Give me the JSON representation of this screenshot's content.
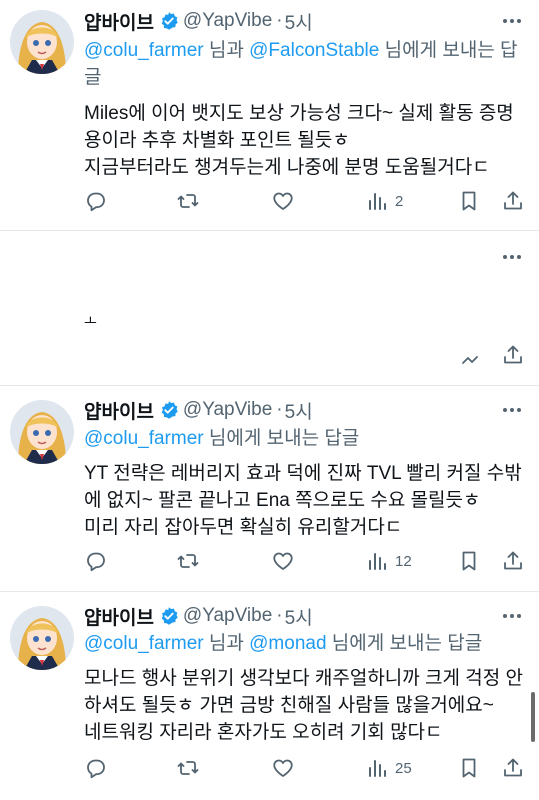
{
  "tweets": [
    {
      "name": "얍바이브",
      "handle": "@YapVibe",
      "time": "5시",
      "reply_prefix": "",
      "mention1": "@colu_farmer",
      "mid": " 님과 ",
      "mention2": "@FalconStable",
      "suffix": " 님에게 보내는 답글",
      "lines": [
        "Miles에 이어 뱃지도 보상 가능성 크다~ 실제 활동 증명",
        "용이라 추후 차별화 포인트 될듯ㅎ",
        "지금부터라도 챙겨두는게 나중에 분명 도움될거다ㄷ"
      ],
      "views": "2"
    },
    {
      "name": "얍바이브",
      "handle": "@YapVibe",
      "time": "5시",
      "mention1": "@colu_farmer",
      "suffix": " 님에게 보내는 답글",
      "lines": [
        "YT 전략은 레버리지 효과 덕에 진짜 TVL 빨리 커질 수밖",
        "에 없지~ 팔콘 끝나고 Ena 쪽으로도 수요 몰릴듯ㅎ",
        "미리 자리 잡아두면 확실히 유리할거다ㄷ"
      ],
      "views": "12"
    },
    {
      "name": "얍바이브",
      "handle": "@YapVibe",
      "time": "5시",
      "mention1": "@colu_farmer",
      "mid": " 님과 ",
      "mention2": "@monad",
      "suffix": " 님에게 보내는 답글",
      "lines": [
        "모나드 행사 분위기 생각보다 캐주얼하니까 크게 걱정 안",
        "하셔도 될듯ㅎ 가면 금방 친해질 사람들 많을거에요~",
        "네트워킹 자리라 혼자가도 오히려 기회 많다ㄷ"
      ],
      "views": "25"
    }
  ],
  "partial_text": "ㅗ",
  "icons": {
    "reply": "reply-icon",
    "retweet": "retweet-icon",
    "like": "heart-icon",
    "views": "views-icon",
    "bookmark": "bookmark-icon",
    "share": "share-icon",
    "more": "more-icon",
    "verified": "verified-badge-icon"
  },
  "colors": {
    "link": "#1d9bf0",
    "secondary": "#536471",
    "text": "#0f1419",
    "verified": "#1d9bf0"
  }
}
